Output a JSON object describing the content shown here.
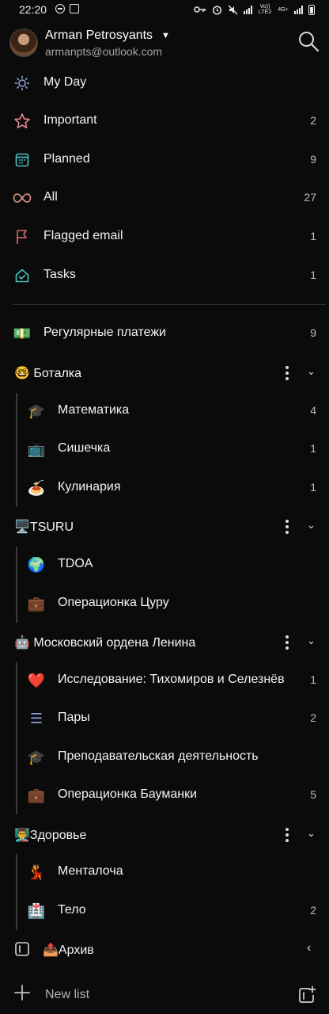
{
  "status_bar": {
    "time": "22:20",
    "icons": [
      "minus-circle-icon",
      "gallery-icon",
      "key-icon",
      "alarm-icon",
      "mute-icon",
      "signal-icon",
      "battery-icon"
    ],
    "network_1": "Vo)) LTE2",
    "network_2": "4G+"
  },
  "account": {
    "name": "Arman Petrosyants",
    "email": "armanpts@outlook.com"
  },
  "smart_lists": [
    {
      "icon": "sun-icon",
      "label": "My Day",
      "count": ""
    },
    {
      "icon": "star-icon",
      "label": "Important",
      "count": "2"
    },
    {
      "icon": "calendar-icon",
      "label": "Planned",
      "count": "9"
    },
    {
      "icon": "infinity-icon",
      "label": "All",
      "count": "27"
    },
    {
      "icon": "flag-icon",
      "label": "Flagged email",
      "count": "1"
    },
    {
      "icon": "house-check-icon",
      "label": "Tasks",
      "count": "1"
    }
  ],
  "standalone_list": {
    "emoji": "💵",
    "label": "Регулярные платежи",
    "count": "9"
  },
  "groups": [
    {
      "title": "🤓 Боталка",
      "lists": [
        {
          "emoji": "🎓",
          "label": "Математика",
          "count": "4"
        },
        {
          "emoji": "📺",
          "label": "Сишечка",
          "count": "1"
        },
        {
          "emoji": "🍝",
          "label": "Кулинария",
          "count": "1"
        }
      ]
    },
    {
      "title": "🖥️TSURU",
      "lists": [
        {
          "emoji": "🌍",
          "label": "TDOA",
          "count": ""
        },
        {
          "emoji": "💼",
          "label": "Операционка Цуру",
          "count": ""
        }
      ]
    },
    {
      "title": "🤖 Московский ордена Ленина",
      "lists": [
        {
          "emoji": "❤️",
          "label": "Исследование: Тихомиров и Селезнёв",
          "count": "1"
        },
        {
          "emoji": "☰",
          "label": "Пары",
          "count": "2"
        },
        {
          "emoji": "🎓",
          "label": "Преподавательская деятельность",
          "count": ""
        },
        {
          "emoji": "💼",
          "label": "Операционка Бауманки",
          "count": "5"
        }
      ]
    },
    {
      "title": "👨‍🏫Здоровье",
      "lists": [
        {
          "emoji": "💃",
          "label": "Менталоча",
          "count": ""
        },
        {
          "emoji": "🏥",
          "label": "Тело",
          "count": "2"
        }
      ]
    }
  ],
  "archive_group": {
    "title": "📤Архив"
  },
  "footer": {
    "new_list_label": "New list"
  },
  "colors": {
    "background": "#0b0b0b",
    "sun": "#8ea3d9",
    "star": "#e8878f",
    "calendar": "#4dc1c7",
    "infinity": "#e39a84",
    "flag": "#e06a6a",
    "tasks": "#4ac3c3"
  }
}
